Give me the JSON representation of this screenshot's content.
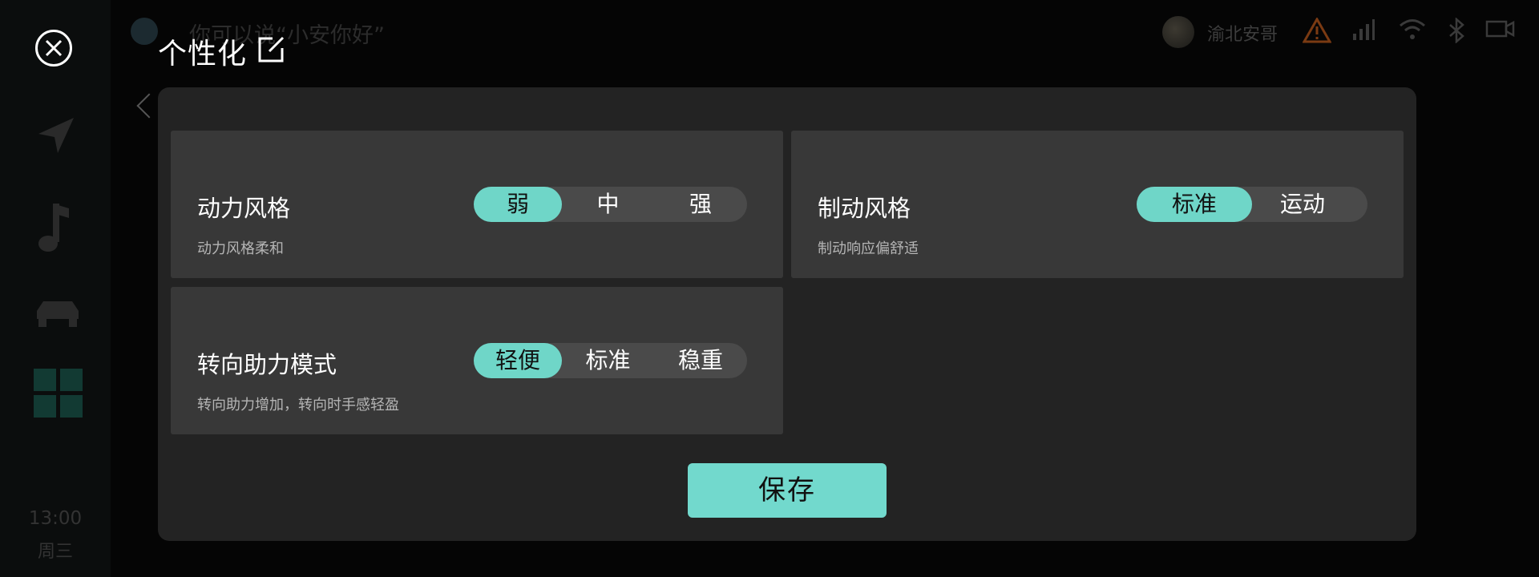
{
  "background": {
    "voice_hint": "你可以说“小安你好”",
    "user_name": "渝北安哥",
    "time": "13:00",
    "weekday": "周三"
  },
  "modal": {
    "title": "个性化",
    "save_label": "保存"
  },
  "settings": [
    {
      "title": "动力风格",
      "description": "动力风格柔和",
      "options": [
        "弱",
        "中",
        "强"
      ],
      "selected": "弱"
    },
    {
      "title": "制动风格",
      "description": "制动响应偏舒适",
      "options": [
        "标准",
        "运动"
      ],
      "selected": "标准"
    },
    {
      "title": "转向助力模式",
      "description": "转向助力增加，转向时手感轻盈",
      "options": [
        "轻便",
        "标准",
        "稳重"
      ],
      "selected": "轻便"
    }
  ],
  "colors": {
    "accent": "#72d9cd",
    "card_bg": "#383838",
    "panel_bg": "#232323",
    "warning": "#7a3a12"
  },
  "icons": [
    "close-icon",
    "edit-icon",
    "navigation-icon",
    "music-icon",
    "car-icon",
    "apps-icon",
    "warning-icon",
    "signal-icon",
    "wifi-icon",
    "bluetooth-icon",
    "camera-icon"
  ]
}
